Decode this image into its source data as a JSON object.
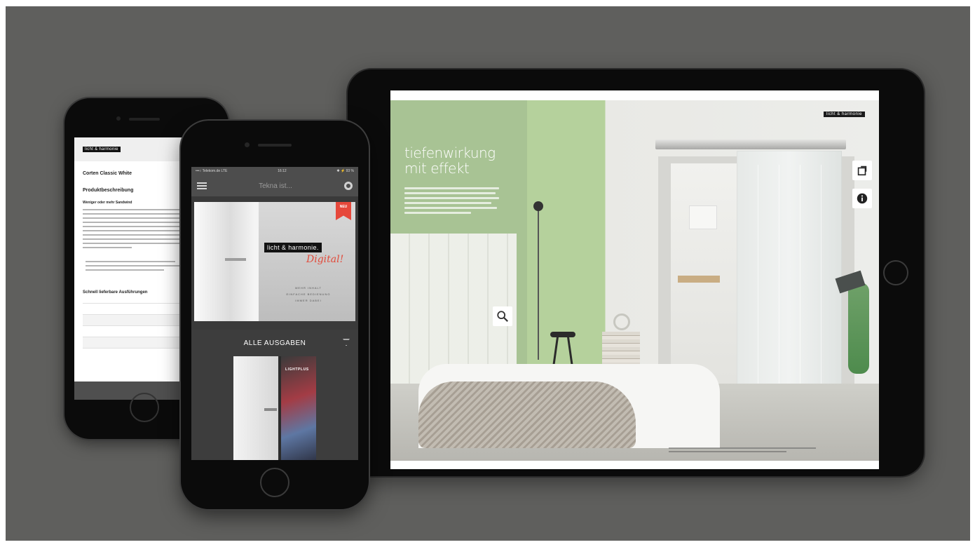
{
  "colors": {
    "background": "#5f5f5d",
    "device": "#0b0b0b",
    "accent_red": "#e14c3c",
    "wall_green": "#b5d19c"
  },
  "tablet": {
    "headline_line1": "tiefenwirkung",
    "headline_line2": "mit effekt",
    "brand_tag": "licht & harmonie",
    "icons": [
      "search-icon",
      "export-icon",
      "info-icon"
    ]
  },
  "phone_back": {
    "brand_tag": "licht & harmonie",
    "product_title": "Corten Classic White",
    "section_description": "Produktbeschreibung",
    "subheading": "Weniger oder mehr Sandwind",
    "section_variants": "Schnell lieferbare Ausführungen"
  },
  "phone_front": {
    "status_carrier": "•••○ Telekom.de  LTE",
    "status_time": "16:12",
    "status_battery": "✱ ⚡ 93 %",
    "search_placeholder": "Tekna ist...",
    "hero_badge": "NEU",
    "hero_brand": "licht & harmonie.",
    "hero_script": "Digital!",
    "hero_sub_line1": "MEHR INHALT",
    "hero_sub_line2": "EINFACHE BEDIENUNG",
    "hero_sub_line3": "IMMER DABEI",
    "section_title": "ALLE AUSGABEN",
    "cover_brand": "LIGHTPLUS",
    "icons": [
      "menu-icon",
      "settings-icon",
      "filter-icon"
    ]
  }
}
